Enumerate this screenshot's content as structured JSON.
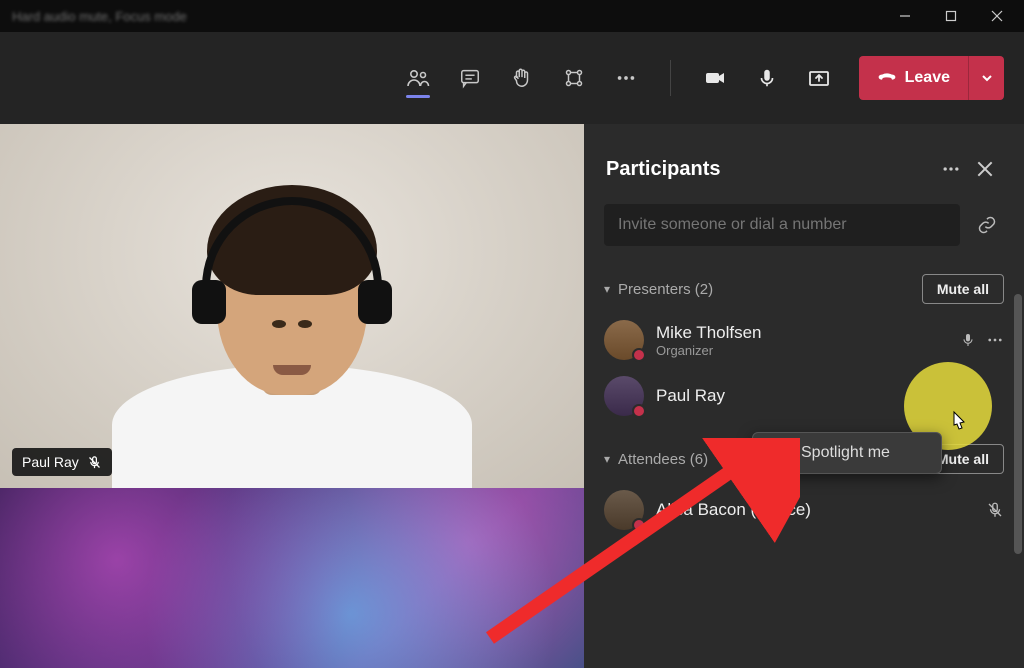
{
  "titlebar": {
    "text": "Hard audio mute, Focus mode"
  },
  "toolbar": {
    "leave_label": "Leave"
  },
  "video": {
    "tile1_name": "Paul Ray"
  },
  "panel": {
    "title": "Participants",
    "invite_placeholder": "Invite someone or dial a number",
    "presenters_label": "Presenters (2)",
    "attendees_label": "Attendees (6)",
    "mute_all_label": "Mute all",
    "presenters": [
      {
        "name": "Mike Tholfsen",
        "role": "Organizer"
      },
      {
        "name": "Paul Ray",
        "role": ""
      }
    ],
    "attendees": [
      {
        "name": "Alisa Bacon (Kforce)"
      }
    ]
  },
  "context_menu": {
    "spotlight_label": "Spotlight me"
  }
}
